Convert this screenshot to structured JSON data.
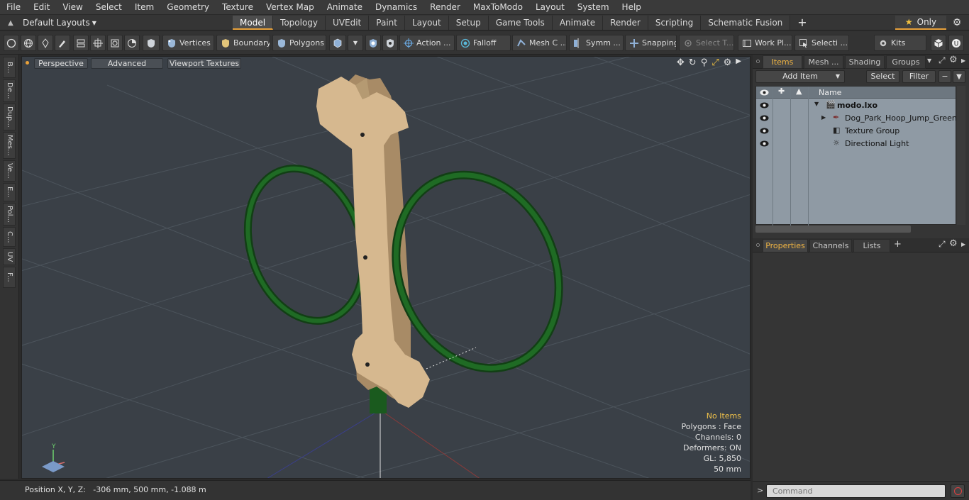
{
  "menu": [
    "File",
    "Edit",
    "View",
    "Select",
    "Item",
    "Geometry",
    "Texture",
    "Vertex Map",
    "Animate",
    "Dynamics",
    "Render",
    "MaxToModo",
    "Layout",
    "System",
    "Help"
  ],
  "layout_select": "Default Layouts",
  "tabs": [
    "Model",
    "Topology",
    "UVEdit",
    "Paint",
    "Layout",
    "Setup",
    "Game Tools",
    "Animate",
    "Render",
    "Scripting",
    "Schematic Fusion"
  ],
  "active_tab": "Model",
  "only_label": "Only",
  "toolbar": {
    "vertices": "Vertices",
    "boundary": "Boundary",
    "polygons": "Polygons",
    "action": "Action ...",
    "falloff": "Falloff",
    "mesh_c": "Mesh C ...",
    "symm": "Symm ...",
    "snapping": "Snapping",
    "select_t": "Select T...",
    "work_pl": "Work Pl...",
    "selecti": "Selecti ...",
    "kits": "Kits"
  },
  "left_strip": [
    "B...",
    "De...",
    "Dup...",
    "Mes...",
    "Ve...",
    "E...",
    "Pol...",
    "C...",
    "UV",
    "F..."
  ],
  "viewport": {
    "perspective": "Perspective",
    "advanced": "Advanced",
    "textures": "Viewport Textures",
    "info": {
      "no_items": "No Items",
      "polygons": "Polygons : Face",
      "channels": "Channels: 0",
      "deformers": "Deformers: ON",
      "gl": "GL: 5,850",
      "scale": "50 mm"
    },
    "axis_y": "Y"
  },
  "status": "Position X, Y, Z:   -306 mm, 500 mm, -1.088 m",
  "items_panel": {
    "tabs": [
      "Items",
      "Mesh ...",
      "Shading",
      "Groups"
    ],
    "add_item": "Add Item",
    "select": "Select",
    "filter": "Filter",
    "name_header": "Name",
    "rows": [
      {
        "label": "modo.lxo"
      },
      {
        "label": "Dog_Park_Hoop_Jump_Green"
      },
      {
        "label": "Texture Group"
      },
      {
        "label": "Directional Light"
      }
    ]
  },
  "props_panel": {
    "tabs": [
      "Properties",
      "Channels",
      "Lists"
    ]
  },
  "command_placeholder": "Command",
  "colors": {
    "accent": "#e8a13a",
    "viewport_bg": "#3a4047",
    "bone": "#d6b88f",
    "hoop": "#1e6a22",
    "items_bg": "#8f9aa4"
  }
}
